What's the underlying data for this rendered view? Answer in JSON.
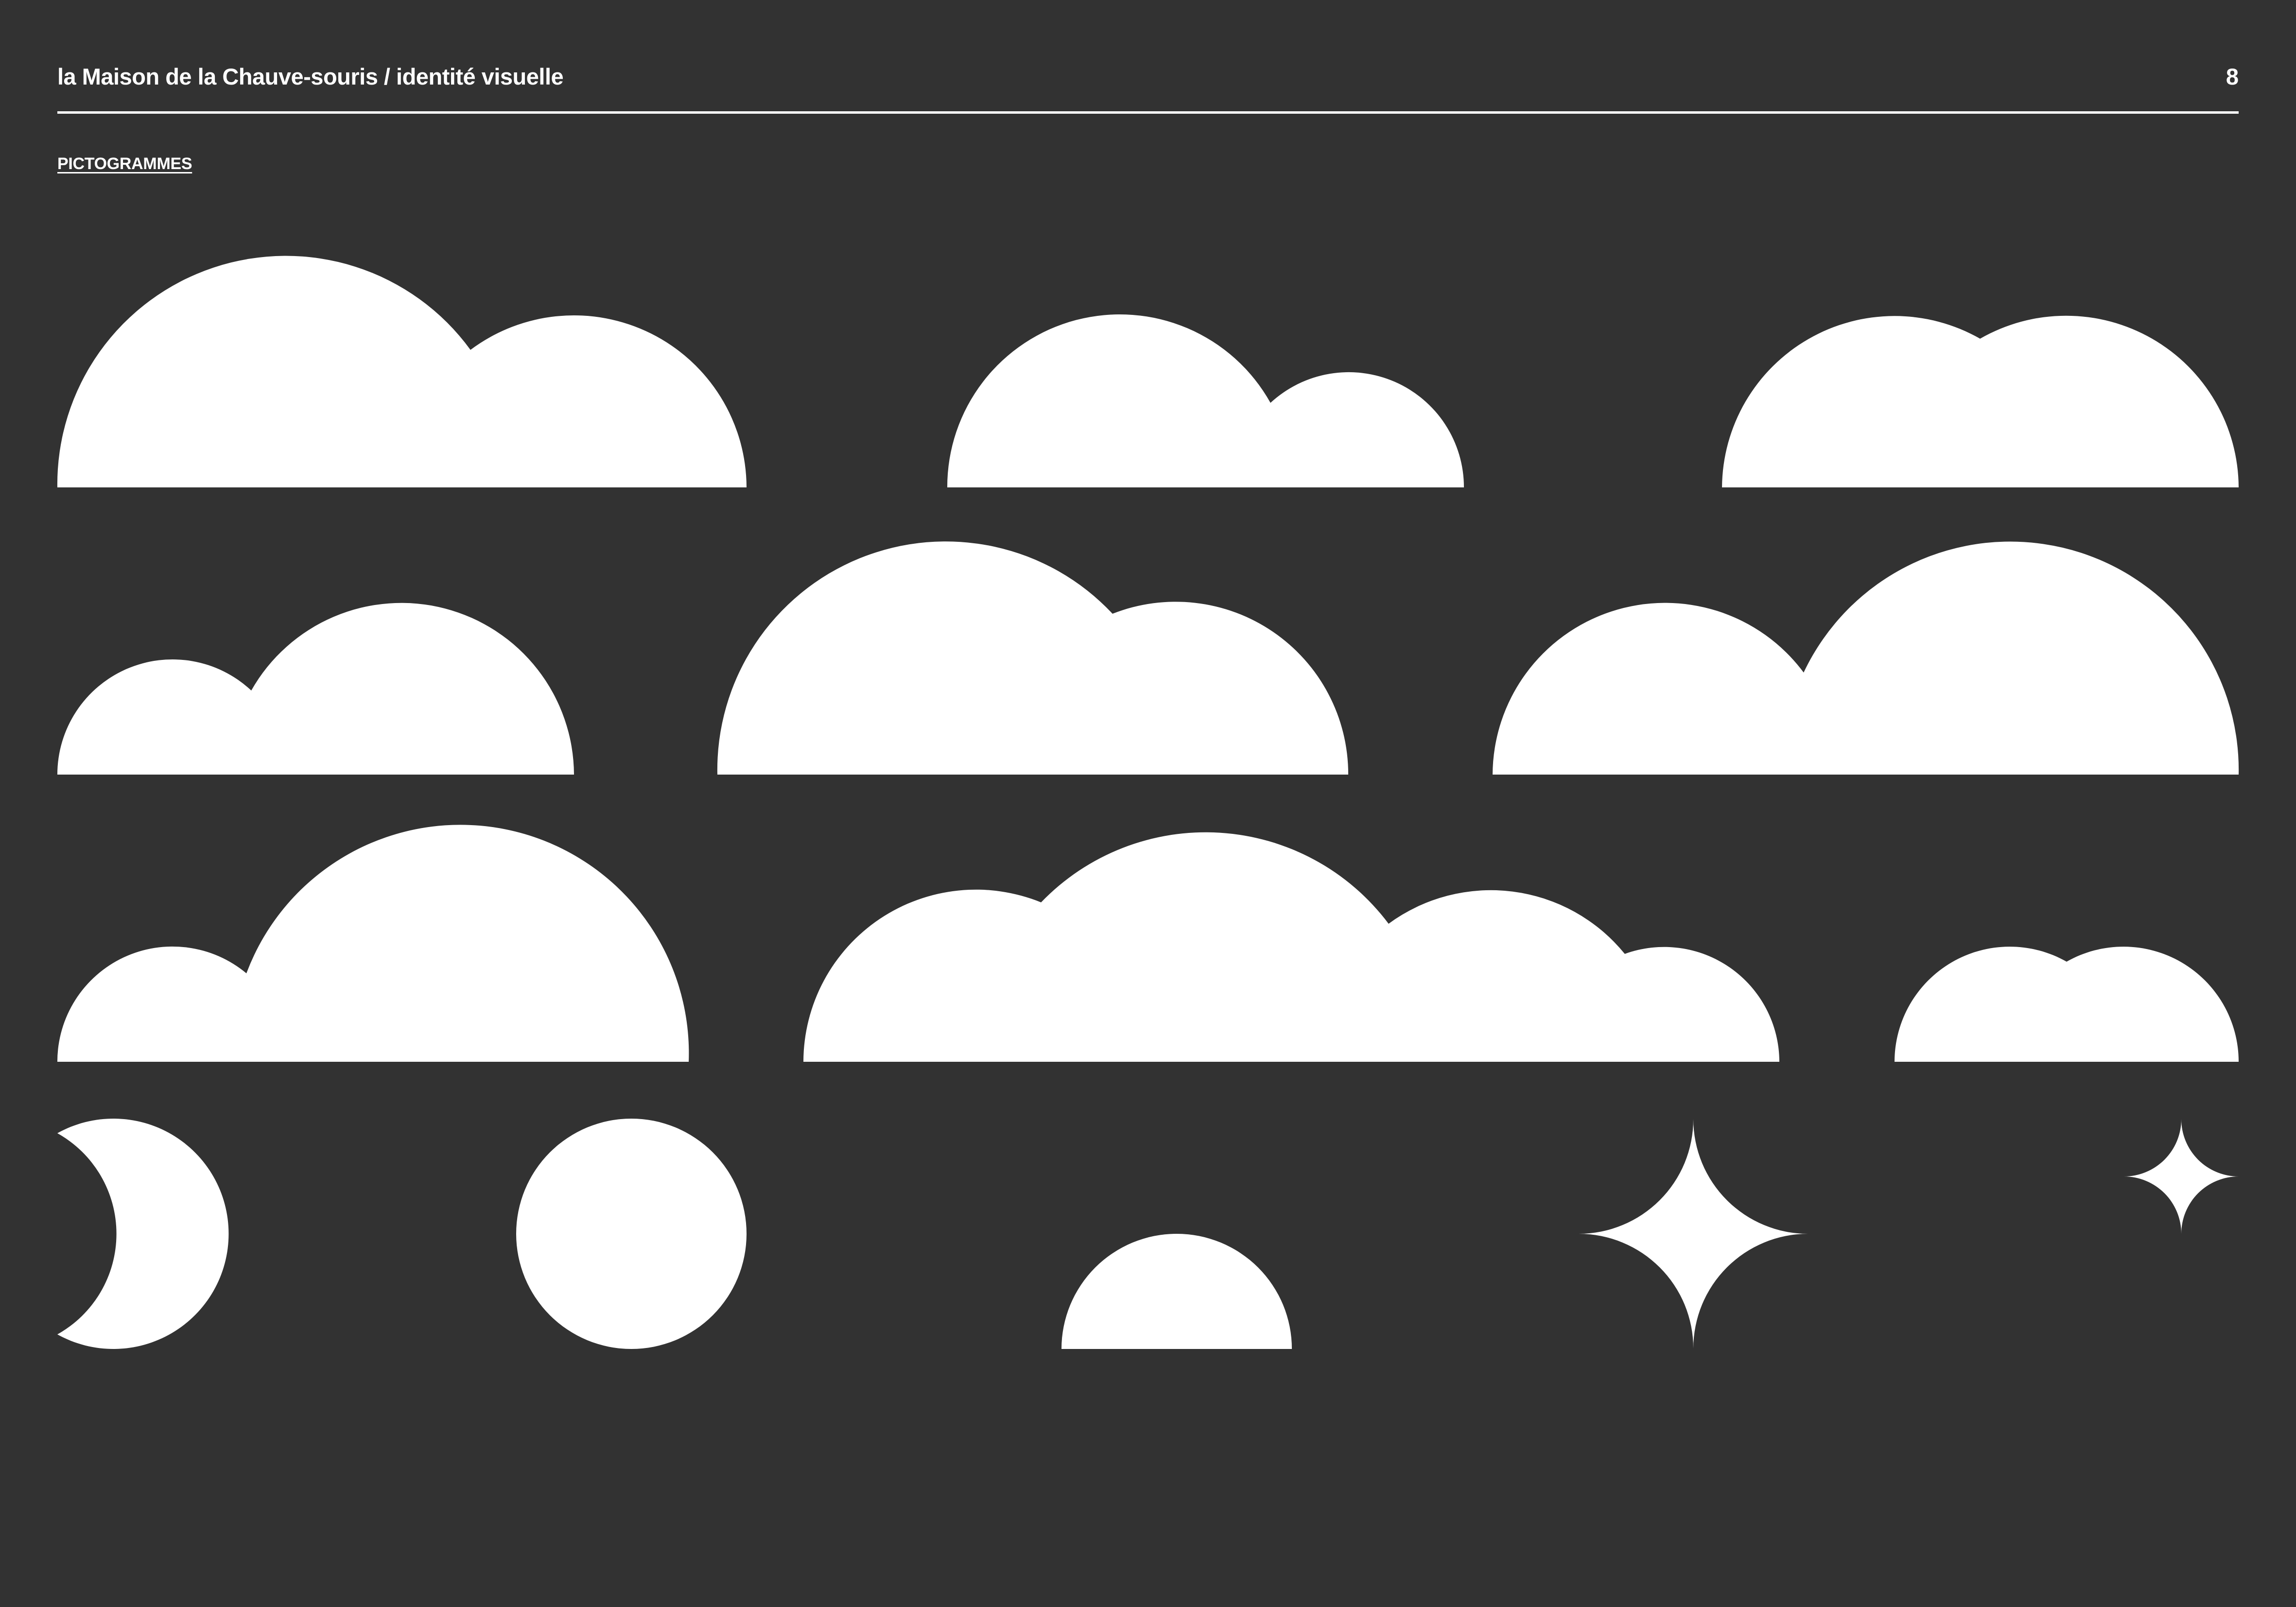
{
  "header": {
    "title": "la Maison de la Chauve-souris / identité visuelle",
    "page_number": "8"
  },
  "section": {
    "heading": "PICTOGRAMMES"
  },
  "colors": {
    "background": "#323232",
    "foreground": "#ffffff"
  },
  "pictograms": [
    {
      "name": "cloud-icon",
      "variant": "large-two-puff"
    },
    {
      "name": "cloud-icon",
      "variant": "medium-two-puff"
    },
    {
      "name": "cloud-icon",
      "variant": "twin-puff"
    },
    {
      "name": "cloud-icon",
      "variant": "small-left-puff"
    },
    {
      "name": "cloud-icon",
      "variant": "big-left-puff"
    },
    {
      "name": "cloud-icon",
      "variant": "big-right-puff"
    },
    {
      "name": "cloud-icon",
      "variant": "tall-right-puff"
    },
    {
      "name": "cloud-icon",
      "variant": "long-four-puff"
    },
    {
      "name": "cloud-icon",
      "variant": "small-twin-puff"
    },
    {
      "name": "crescent-moon-icon"
    },
    {
      "name": "full-moon-icon"
    },
    {
      "name": "half-sun-icon"
    },
    {
      "name": "large-star-icon"
    },
    {
      "name": "small-star-icon"
    }
  ]
}
